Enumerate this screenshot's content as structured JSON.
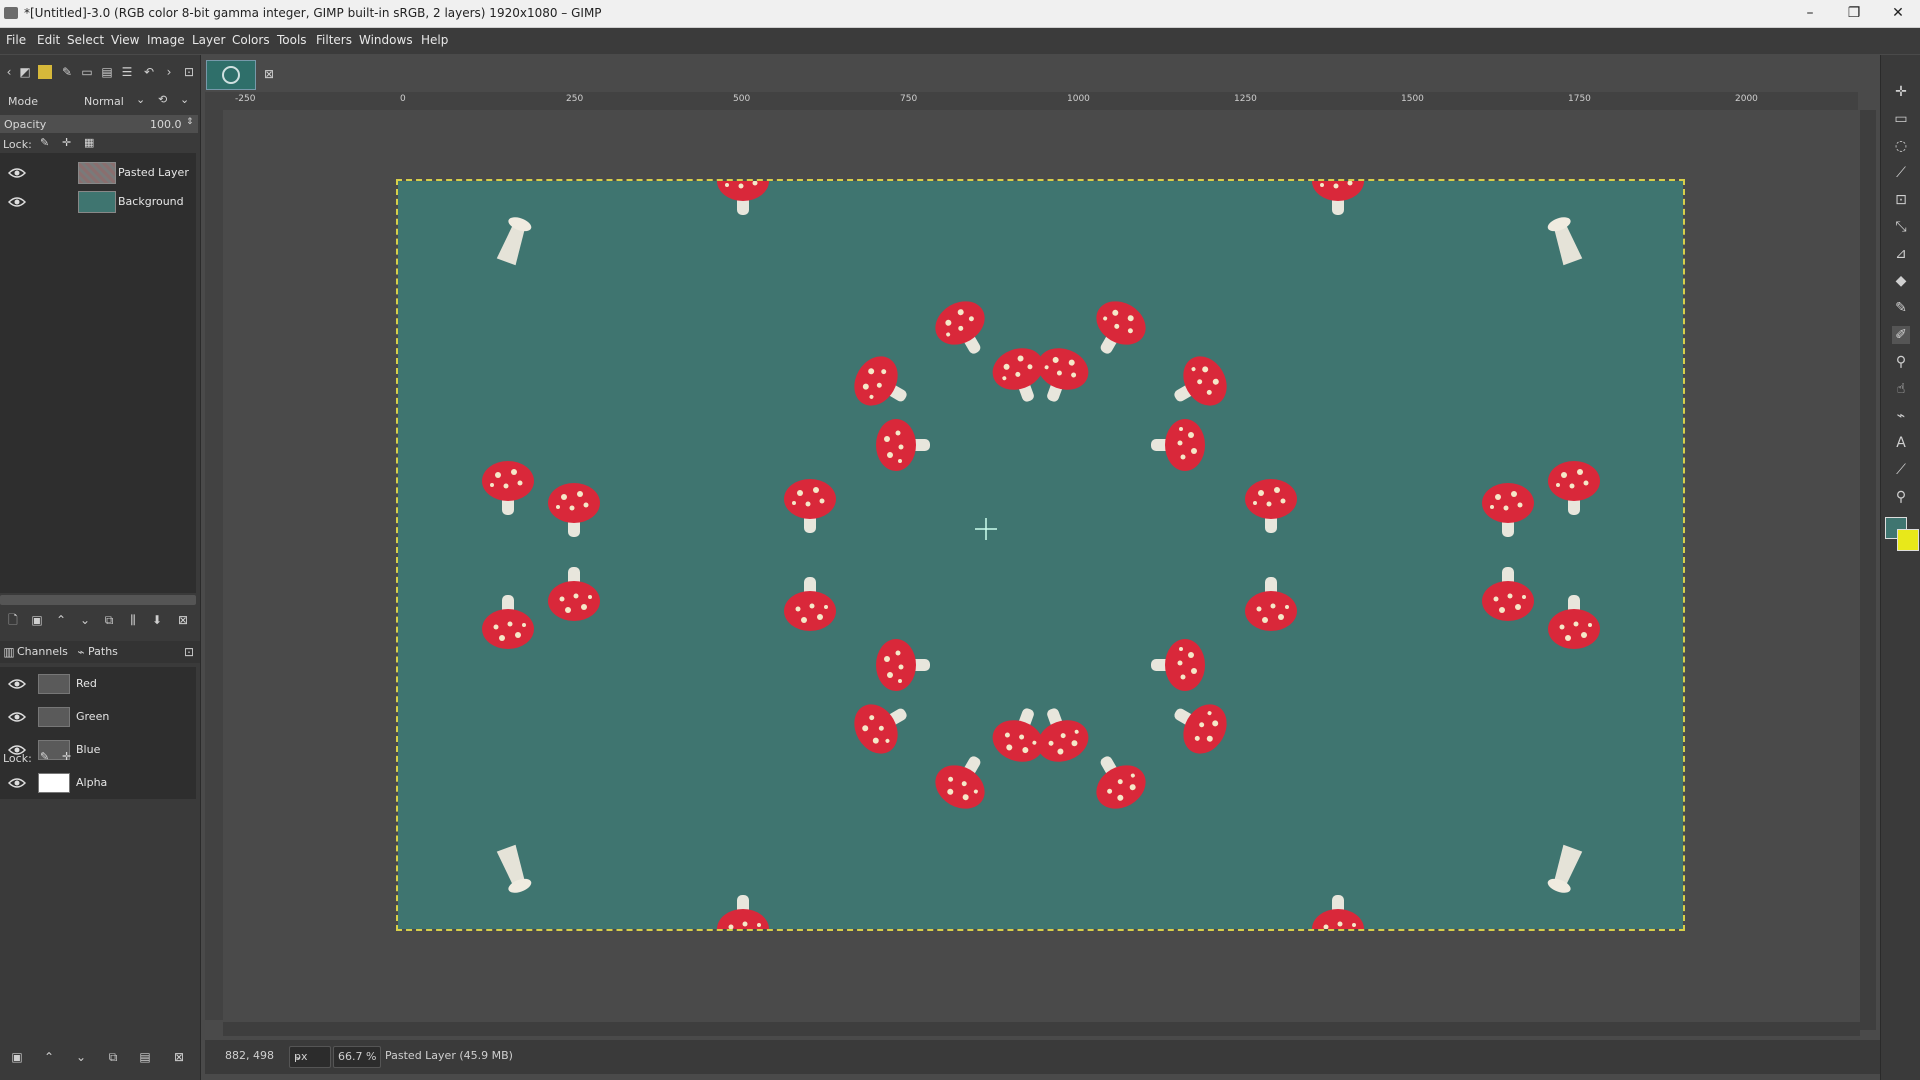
{
  "window": {
    "title": "*[Untitled]-3.0 (RGB color 8-bit gamma integer, GIMP built-in sRGB, 2 layers) 1920x1080 – GIMP",
    "minimize": "–",
    "maximize": "❐",
    "close": "✕"
  },
  "menu": [
    "File",
    "Edit",
    "Select",
    "View",
    "Image",
    "Layer",
    "Colors",
    "Tools",
    "Filters",
    "Windows",
    "Help"
  ],
  "layers_panel": {
    "mode_label": "Mode",
    "mode_value": "Normal",
    "opacity_label": "Opacity",
    "opacity_value": "100.0",
    "lock_label": "Lock:",
    "layers": [
      {
        "name": "Pasted Layer"
      },
      {
        "name": "Background"
      }
    ]
  },
  "channels_panel": {
    "tabs": [
      "Channels",
      "Paths"
    ],
    "channels": [
      {
        "name": "Red"
      },
      {
        "name": "Green"
      },
      {
        "name": "Blue"
      },
      {
        "name": "Alpha"
      }
    ],
    "lock_label": "Lock:"
  },
  "rulers": {
    "top": [
      "-250",
      "0",
      "250",
      "500",
      "750",
      "1000",
      "1250",
      "1500",
      "1750",
      "2000"
    ]
  },
  "statusbar": {
    "coords": "882, 498",
    "unit": "px",
    "zoom": "66.7 %",
    "message": "Pasted Layer (45.9 MB)"
  },
  "colors": {
    "foreground": "#3f7570",
    "background": "#e8e81a",
    "canvas_bg": "#3f7570"
  },
  "icons": {
    "title_icon": "gimp-icon",
    "crosshair": "move-crosshair-icon"
  }
}
